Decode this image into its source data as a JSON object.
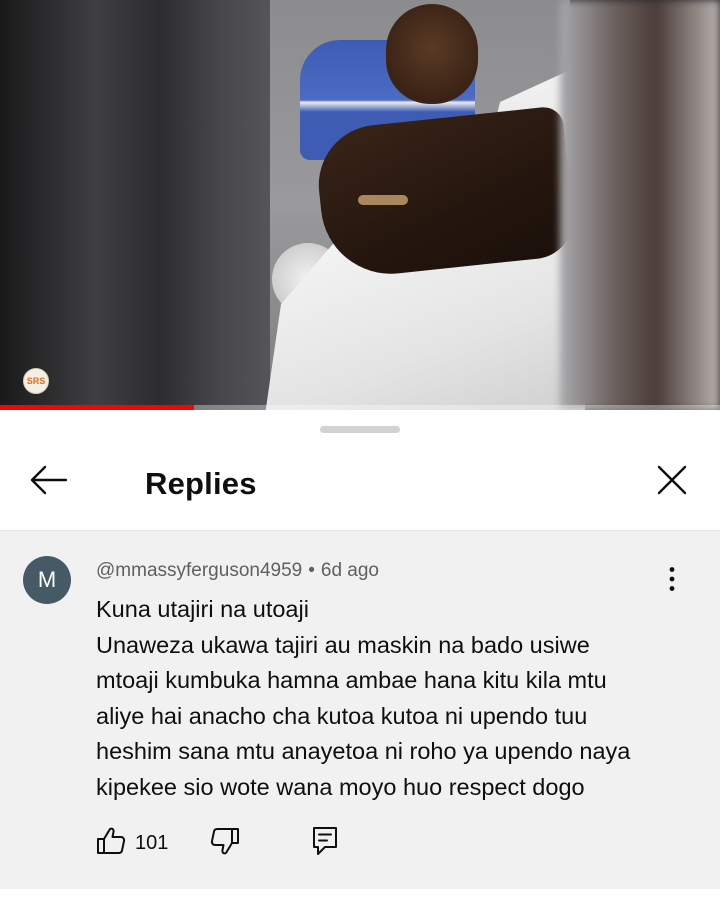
{
  "video": {
    "channel_badge": "SRS",
    "progress_fraction": 0.27,
    "progress_color": "#ff0000"
  },
  "sheet": {
    "title": "Replies",
    "back_icon": "arrow-left-icon",
    "close_icon": "close-icon"
  },
  "comment": {
    "avatar_letter": "M",
    "avatar_color": "#455a64",
    "author": "@mmassyferguson4959",
    "separator": "•",
    "time": "6d ago",
    "lines": [
      "Kuna utajiri na utoaji",
      "Unaweza ukawa tajiri au maskin na bado usiwe",
      "mtoaji kumbuka hamna ambae hana kitu kila mtu",
      "aliye hai anacho cha kutoa kutoa ni upendo tuu",
      "heshim sana mtu anayetoa ni roho ya upendo naya",
      "kipekee sio wote wana moyo huo respect dogo"
    ],
    "like_count": "101",
    "icons": {
      "like": "thumbs-up-icon",
      "dislike": "thumbs-down-icon",
      "reply": "reply-comment-icon",
      "menu": "more-vertical-icon"
    }
  }
}
